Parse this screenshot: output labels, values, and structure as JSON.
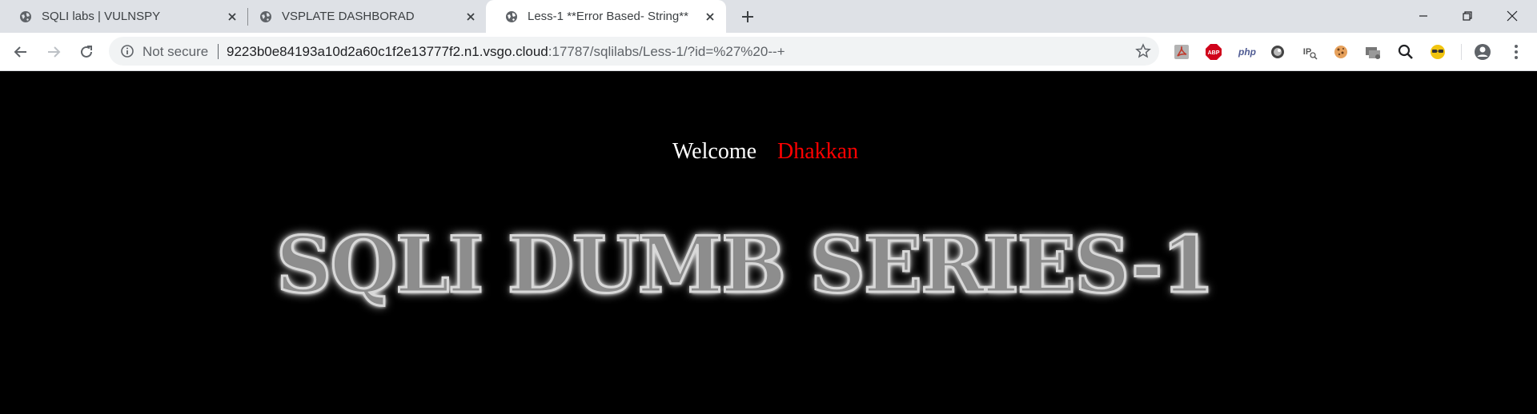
{
  "browser": {
    "tabs": [
      {
        "title": "SQLI labs | VULNSPY",
        "active": false
      },
      {
        "title": "VSPLATE DASHBORAD",
        "active": false
      },
      {
        "title": "Less-1 **Error Based- String**",
        "active": true
      }
    ],
    "address_bar": {
      "security_label": "Not secure",
      "url_host": "9223b0e84193a10d2a60c1f2e13777f2.n1.vsgo.cloud",
      "url_rest": ":17787/sqlilabs/Less-1/?id=%27%20--+"
    },
    "extensions": [
      {
        "name": "pdf-icon",
        "color": "#c0392b"
      },
      {
        "name": "adblock-icon",
        "label": "ABP",
        "color": "#d0021b"
      },
      {
        "name": "php-icon",
        "label": "php",
        "color": "#4f5b93"
      },
      {
        "name": "circle-extension-icon",
        "color": "#444444"
      },
      {
        "name": "ip-icon",
        "label": "IP",
        "color": "#555555"
      },
      {
        "name": "cookie-icon",
        "color": "#e67e22"
      },
      {
        "name": "network-icon",
        "color": "#666666"
      },
      {
        "name": "magnifier-icon",
        "color": "#202124"
      },
      {
        "name": "glasses-icon",
        "color": "#f1c40f"
      }
    ]
  },
  "page": {
    "welcome_text": "Welcome",
    "user_name": "Dhakkan",
    "banner_title": "SQLI DUMB SERIES-1",
    "colors": {
      "background": "#000000",
      "welcome": "#ffffff",
      "user": "#ff0000"
    }
  }
}
